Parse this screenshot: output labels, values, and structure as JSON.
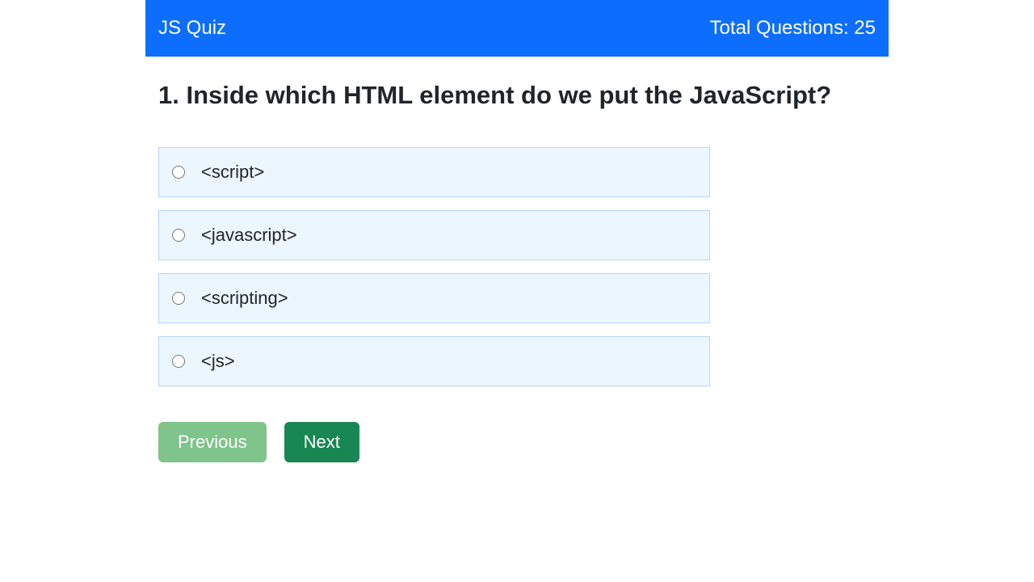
{
  "header": {
    "title": "JS Quiz",
    "total_label": "Total Questions: 25"
  },
  "question": {
    "number": "1",
    "text": "Inside which HTML element do we put the JavaScript?"
  },
  "options": [
    {
      "label": "<script>"
    },
    {
      "label": "<javascript>"
    },
    {
      "label": "<scripting>"
    },
    {
      "label": "<js>"
    }
  ],
  "nav": {
    "previous_label": "Previous",
    "next_label": "Next"
  }
}
